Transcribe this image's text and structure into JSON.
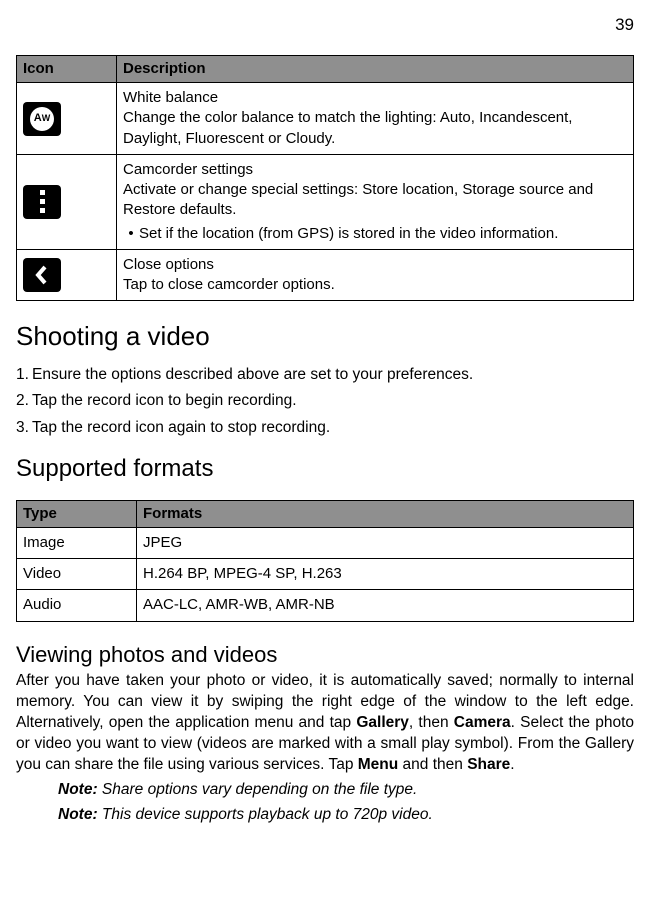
{
  "page_number": "39",
  "icon_table": {
    "headers": {
      "icon": "Icon",
      "description": "Description"
    },
    "rows": [
      {
        "icon_name": "white-balance-icon",
        "title": "White balance",
        "body": "Change the color balance to match the lighting: Auto, Incandescent, Daylight, Fluorescent or Cloudy."
      },
      {
        "icon_name": "camcorder-settings-icon",
        "title": "Camcorder settings",
        "body": "Activate or change special settings: Store location, Storage source and Restore defaults.",
        "bullet": "Set if the location (from GPS) is stored in the video information."
      },
      {
        "icon_name": "close-options-icon",
        "title": "Close options",
        "body": "Tap to close camcorder options."
      }
    ]
  },
  "shooting": {
    "heading": "Shooting a video",
    "steps": [
      "Ensure the options described above are set to your preferences.",
      "Tap the record icon to begin recording.",
      "Tap the record icon again to stop recording."
    ]
  },
  "supported": {
    "heading": "Supported formats",
    "headers": {
      "type": "Type",
      "formats": "Formats"
    },
    "rows": [
      {
        "type": "Image",
        "formats": "JPEG"
      },
      {
        "type": "Video",
        "formats": "H.264 BP, MPEG-4 SP, H.263"
      },
      {
        "type": "Audio",
        "formats": "AAC-LC, AMR-WB, AMR-NB"
      }
    ]
  },
  "viewing": {
    "heading": "Viewing photos and videos",
    "p1a": "After you have taken your photo or video, it is automatically saved; normally to internal memory. You can view it by swiping the right edge of the window to the left edge. Alternatively, open the application menu and tap ",
    "gallery": "Gallery",
    "p1b": ", then ",
    "camera": "Camera",
    "p1c": ". Select the photo or video you want to view (videos are marked with a small play symbol). From the Gallery you can share the file using various services. Tap ",
    "menu": "Menu",
    "p1d": " and then ",
    "share": "Share",
    "p1e": ".",
    "note1_label": "Note:",
    "note1_text": " Share options vary depending on the file type.",
    "note2_label": "Note:",
    "note2_text": " This device supports playback up to 720p video."
  }
}
